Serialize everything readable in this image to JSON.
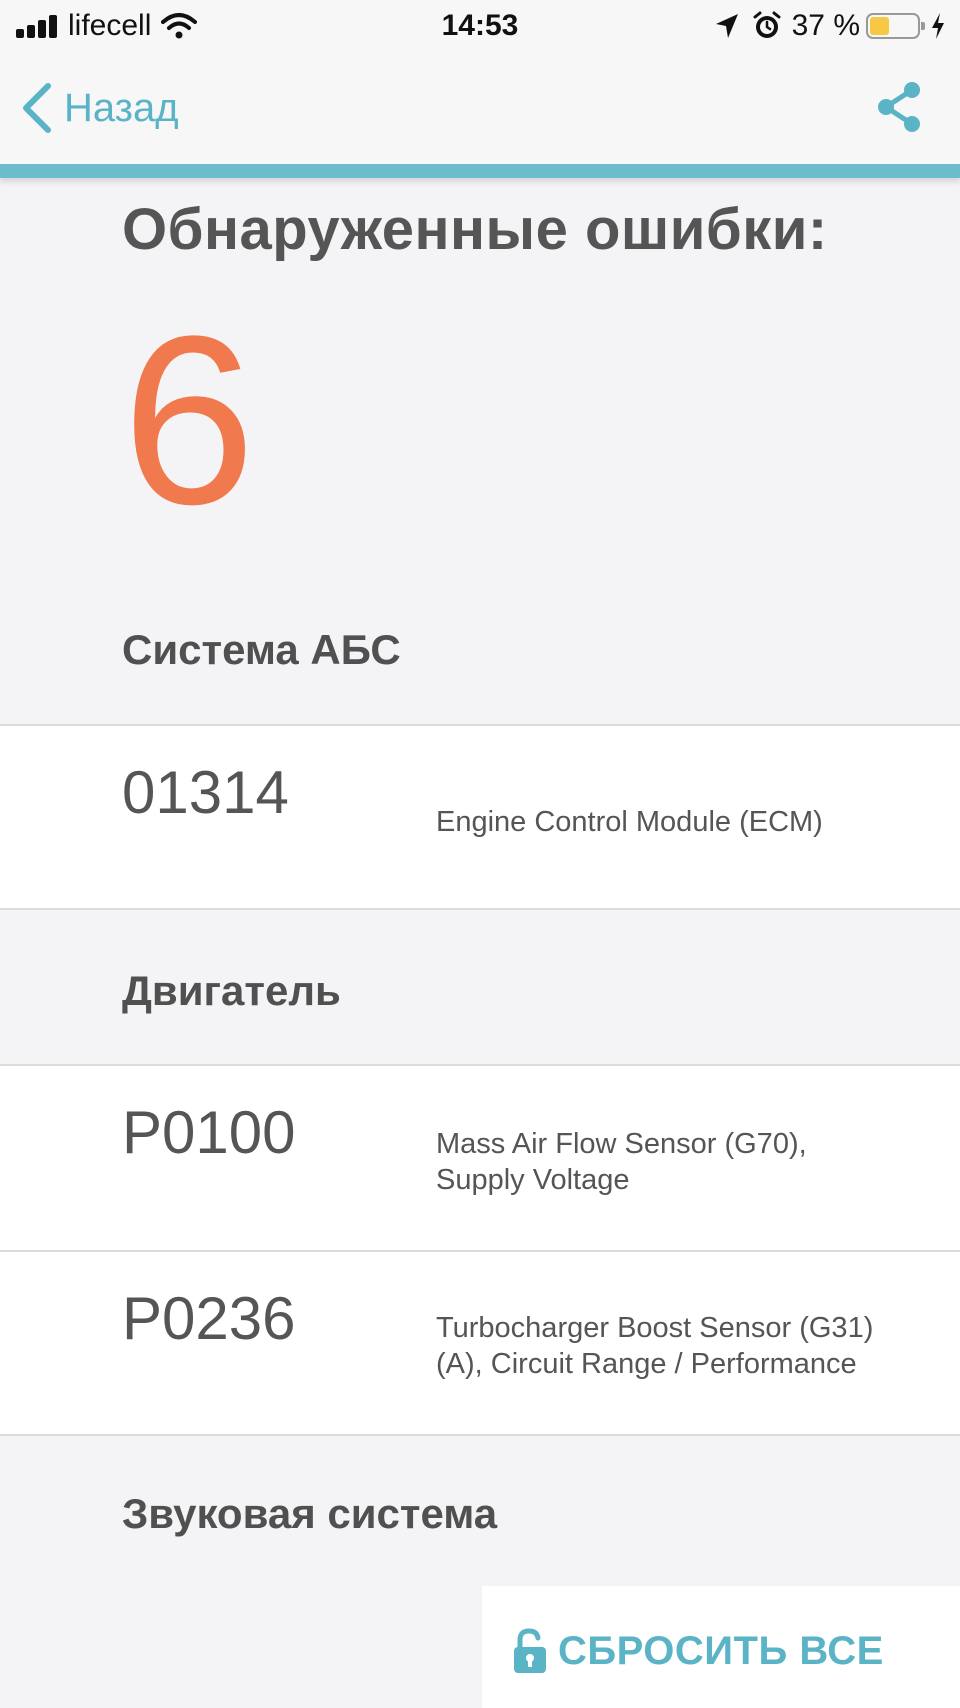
{
  "status_bar": {
    "carrier": "lifecell",
    "time": "14:53",
    "battery_percent": "37 %",
    "battery_level": 0.37,
    "icons": [
      "signal-icon",
      "wifi-icon",
      "location-icon",
      "alarm-icon",
      "battery-icon",
      "charging-icon"
    ]
  },
  "nav": {
    "back_label": "Назад",
    "back_icon": "chevron-left-icon",
    "share_icon": "share-icon",
    "accent_color": "#5bb3c6"
  },
  "summary": {
    "title": "Обнаруженные ошибки:",
    "count": "6",
    "count_color": "#f07a4d"
  },
  "sections": [
    {
      "title": "Система АБС",
      "errors": [
        {
          "code": "01314",
          "description": "Engine Control Module (ECM)"
        }
      ]
    },
    {
      "title": "Двигатель",
      "errors": [
        {
          "code": "P0100",
          "description": "Mass Air Flow Sensor (G70),\nSupply Voltage"
        },
        {
          "code": "P0236",
          "description": "Turbocharger Boost Sensor (G31)\n(A), Circuit Range / Performance"
        }
      ]
    },
    {
      "title": "Звуковая система",
      "errors": []
    }
  ],
  "footer": {
    "reset_label": "СБРОСИТЬ ВСЕ",
    "reset_icon": "unlock-icon"
  }
}
